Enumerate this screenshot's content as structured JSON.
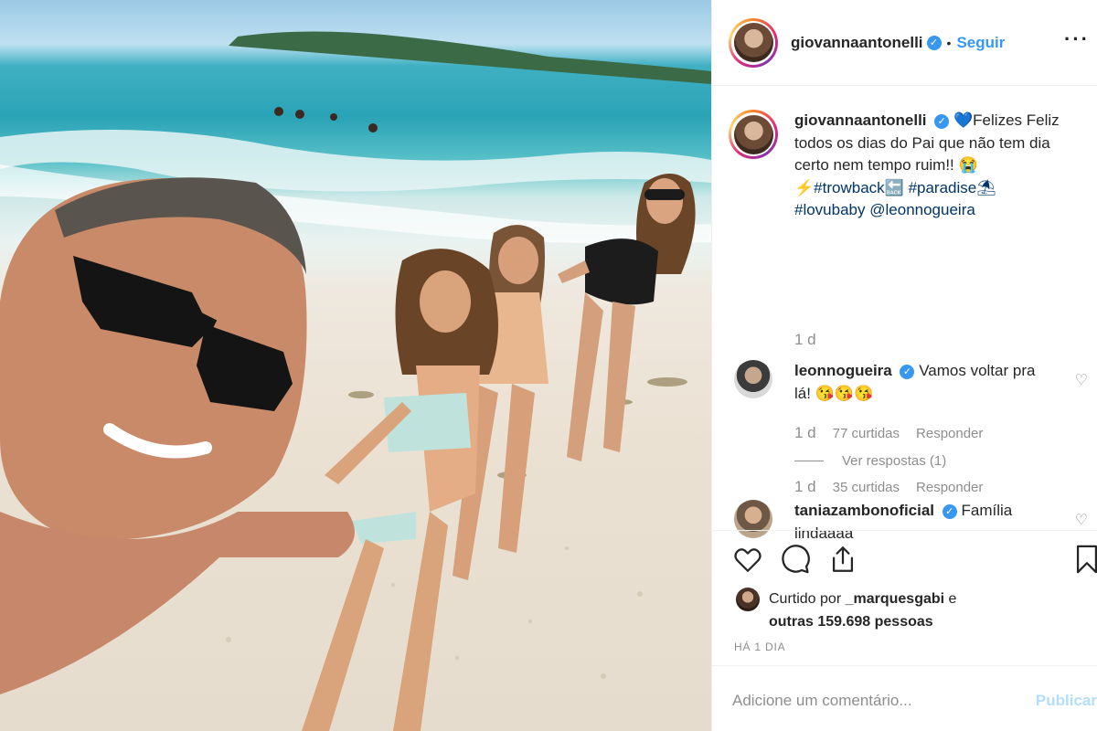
{
  "post": {
    "author": "giovannaantonelli",
    "follow_label": "Seguir",
    "more_icon": "more-dots-icon",
    "caption": {
      "emoji_heart": "💙",
      "text_line1": "Felizes Feliz",
      "text_line2": "todos os dias do Pai que não tem dia",
      "text_line3": "certo nem tempo ruim!! 😭",
      "tag1_emoji": "⚡",
      "tag1": "#trowback🔙",
      "tag2": "#paradise⛱",
      "tag3": "#lovubaby",
      "mention": "@leonnogueira",
      "time": "1 d"
    }
  },
  "comments": [
    {
      "user": "leonnogueira",
      "text_line1": "Vamos voltar pra",
      "text_line2": "lá! 😘😘😘",
      "time": "1 d",
      "likes": "77 curtidas",
      "reply": "Responder",
      "view_replies": "Ver respostas (1)"
    },
    {
      "user": "taniazambonoficial",
      "text_line1": "Família",
      "text_line2": "lindaaaa",
      "time": "1 d",
      "likes": "35 curtidas",
      "reply": "Responder"
    }
  ],
  "likes": {
    "prefix": "Curtido por",
    "user": "_marquesgabi",
    "joiner": "e",
    "others": "outras 159.698 pessoas"
  },
  "date": "HÁ 1 DIA",
  "add_comment": {
    "placeholder": "Adicione um comentário...",
    "publish": "Publicar"
  },
  "icons": [
    "heart-icon",
    "comment-icon",
    "share-icon",
    "bookmark-icon"
  ],
  "colors": {
    "link": "#3897f0",
    "muted": "#8e8e8e",
    "hashtag": "#003569",
    "publish_disabled": "#b2dffc"
  }
}
